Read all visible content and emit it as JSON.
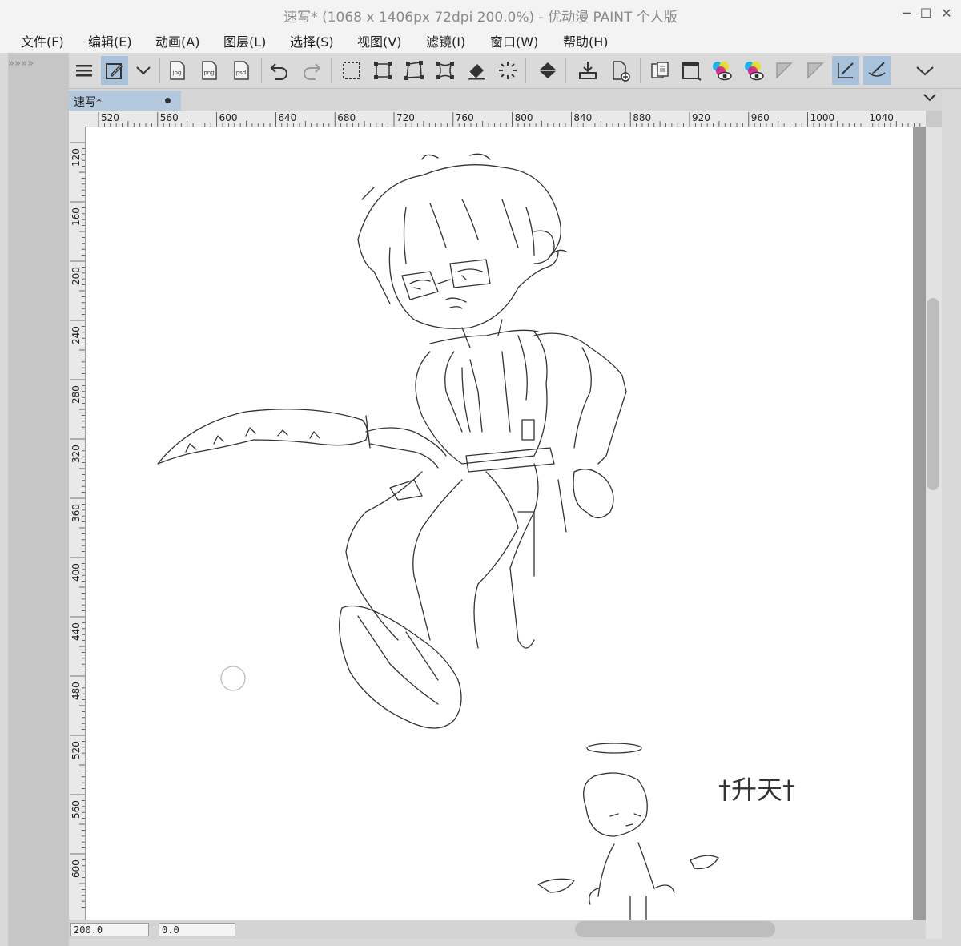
{
  "window": {
    "title": "速写* (1068 x 1406px 72dpi 200.0%)  - 优动漫 PAINT 个人版",
    "controls": {
      "minimize": "─",
      "maximize": "☐",
      "close": "✕"
    }
  },
  "menubar": {
    "items": [
      {
        "label": "文件(F)"
      },
      {
        "label": "编辑(E)"
      },
      {
        "label": "动画(A)"
      },
      {
        "label": "图层(L)"
      },
      {
        "label": "选择(S)"
      },
      {
        "label": "视图(V)"
      },
      {
        "label": "滤镜(I)"
      },
      {
        "label": "窗口(W)"
      },
      {
        "label": "帮助(H)"
      }
    ]
  },
  "left_strip": {
    "arrows": "» » » »"
  },
  "toolbar": {
    "tools": [
      {
        "icon": "menu-icon",
        "active": false
      },
      {
        "icon": "eyedropper-icon",
        "active": true
      },
      {
        "icon": "chevron-down-icon",
        "active": false
      },
      {
        "icon": "export-jpg-icon",
        "label": "jpg",
        "active": false
      },
      {
        "icon": "export-png-icon",
        "label": "png",
        "active": false
      },
      {
        "icon": "export-psd-icon",
        "label": "psd",
        "active": false
      },
      {
        "icon": "undo-icon",
        "active": false
      },
      {
        "icon": "redo-icon",
        "active": false
      },
      {
        "icon": "selection-rect-icon",
        "active": false
      },
      {
        "icon": "transform-scale-icon",
        "active": false
      },
      {
        "icon": "transform-free-icon",
        "active": false
      },
      {
        "icon": "transform-mesh-icon",
        "active": false
      },
      {
        "icon": "eraser-icon",
        "active": false
      },
      {
        "icon": "deselect-icon",
        "active": false
      },
      {
        "icon": "fill-icon",
        "active": false
      },
      {
        "icon": "import-icon",
        "active": false
      },
      {
        "icon": "new-page-icon",
        "active": false
      },
      {
        "icon": "reference-icon",
        "active": false
      },
      {
        "icon": "window-icon",
        "active": false
      },
      {
        "icon": "color-view-icon",
        "active": false
      },
      {
        "icon": "color-view-2-icon",
        "active": false
      },
      {
        "icon": "ruler-off-icon",
        "active": false
      },
      {
        "icon": "ruler-off-2-icon",
        "active": false
      },
      {
        "icon": "snap-icon",
        "active": true
      },
      {
        "icon": "brush-stabilizer-icon",
        "active": true
      },
      {
        "icon": "more-chevron-icon",
        "active": false
      }
    ]
  },
  "tab": {
    "label": "速写*"
  },
  "rulers": {
    "horizontal": [
      "520",
      "560",
      "600",
      "640",
      "680",
      "720",
      "760",
      "800",
      "840",
      "880",
      "920",
      "960",
      "1000",
      "1040"
    ],
    "vertical": [
      "120",
      "160",
      "200",
      "240",
      "280",
      "320",
      "360",
      "400",
      "440",
      "480",
      "520",
      "560",
      "600"
    ]
  },
  "canvas": {
    "doodle_text": "†升天†"
  },
  "status": {
    "zoom": "200.0",
    "rotation": "0.0"
  }
}
